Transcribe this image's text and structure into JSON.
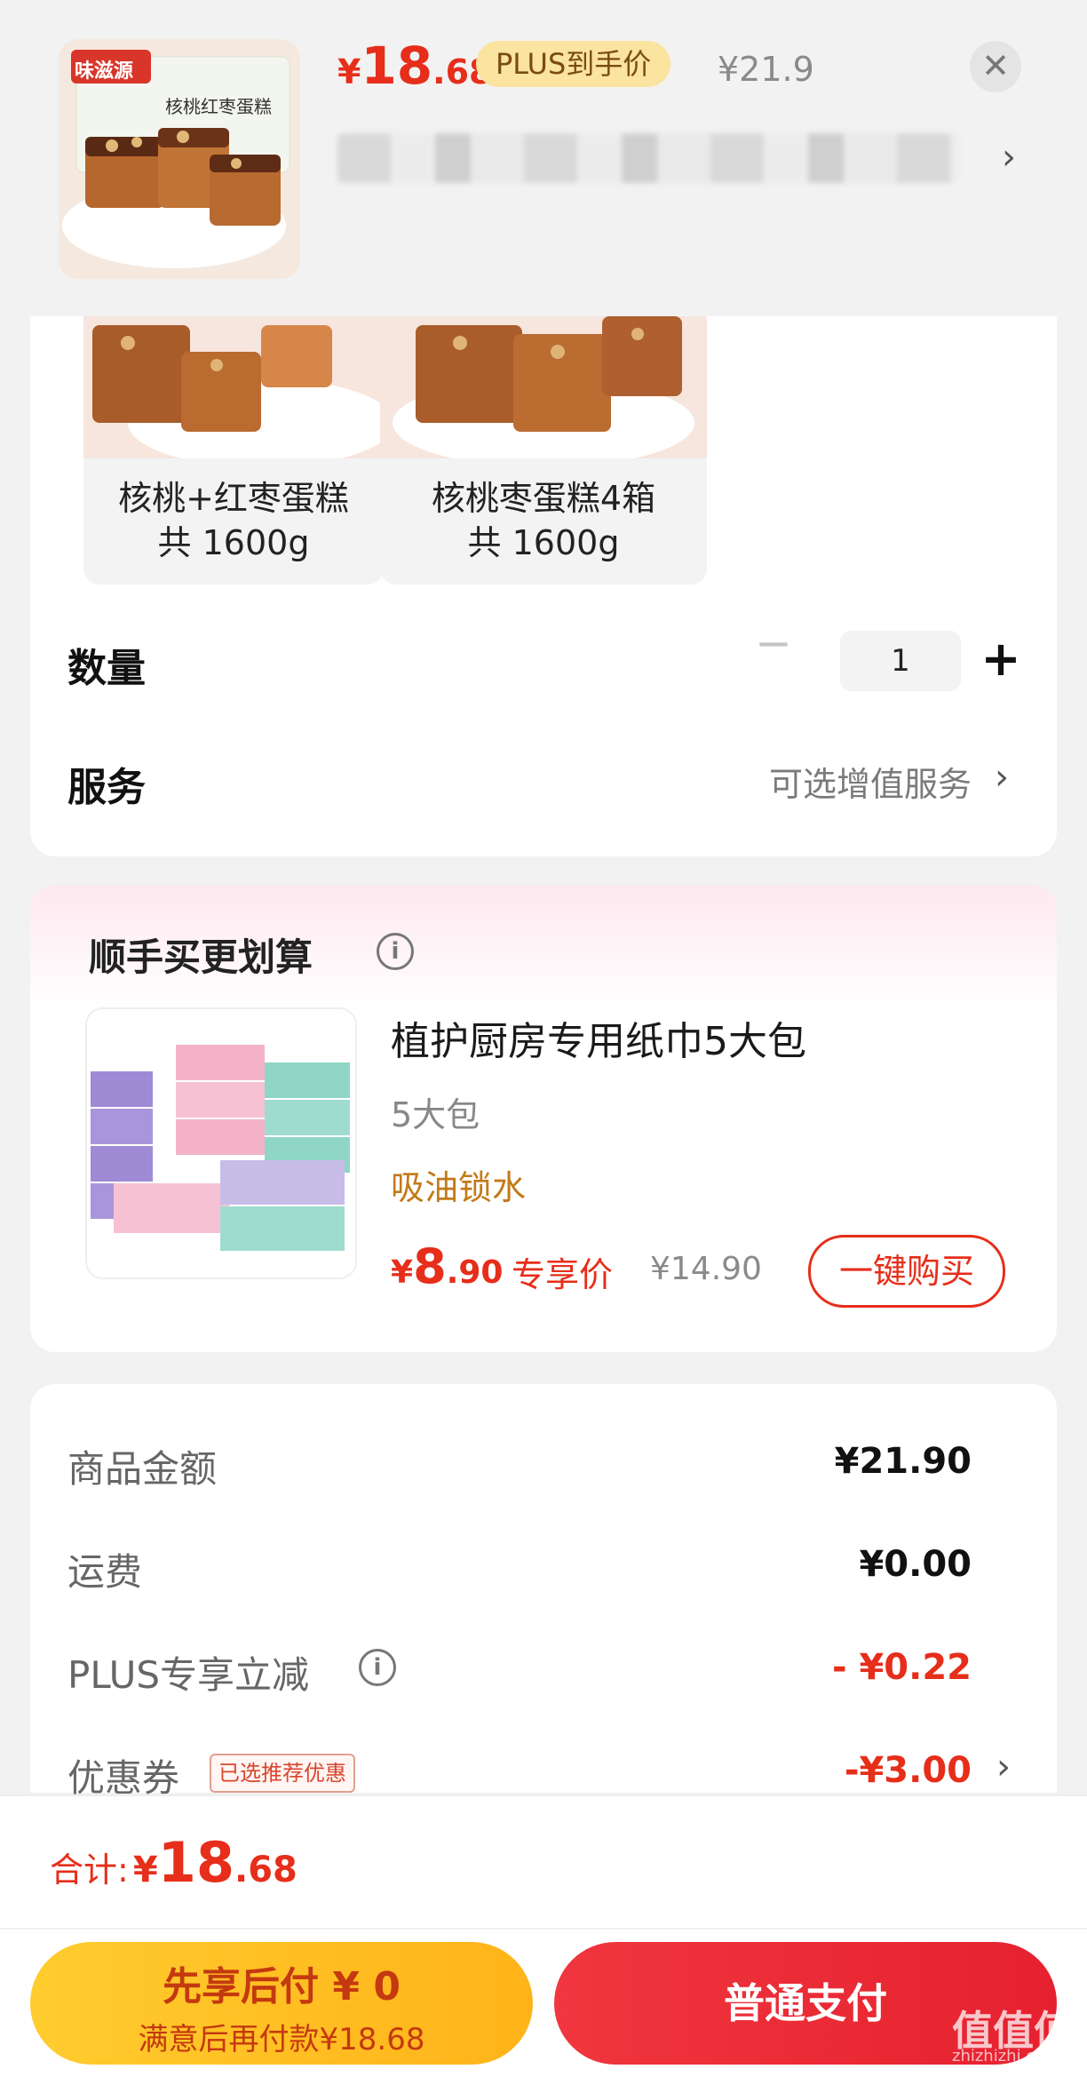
{
  "header": {
    "product_image_text": "味滋源",
    "product_image_caption": "核桃红枣蛋糕",
    "price": {
      "currency": "¥",
      "integer": "18",
      "decimal": ".68"
    },
    "plus_badge": "PLUS到手价",
    "original_price": "¥21.9",
    "close_symbol": "✕",
    "chevron": "›"
  },
  "specs": {
    "items": [
      {
        "name": "核桃+红枣蛋糕",
        "weight": "共 1600g"
      },
      {
        "name": "核桃枣蛋糕4箱",
        "weight": "共 1600g"
      }
    ]
  },
  "quantity": {
    "label": "数量",
    "value": "1",
    "minus": "−",
    "plus": "+"
  },
  "service": {
    "label": "服务",
    "hint": "可选增值服务",
    "chevron": "›"
  },
  "bundle": {
    "title": "顺手买更划算",
    "info_symbol": "i",
    "product": {
      "name": "植护厨房专用纸巾5大包",
      "spec": "5大包",
      "tag": "吸油锁水",
      "price": {
        "currency": "¥",
        "integer": "8",
        "decimal": ".90"
      },
      "exclusive_label": "专享价",
      "original_price": "¥14.90",
      "buy_button": "一键购买"
    }
  },
  "summary": {
    "rows": [
      {
        "label": "商品金额",
        "value": "¥21.90"
      },
      {
        "label": "运费",
        "value": "¥0.00"
      },
      {
        "label": "PLUS专享立减",
        "value": "- ¥0.22"
      },
      {
        "label": "优惠券",
        "value": "-¥3.00"
      }
    ],
    "coupon_badge": "已选推荐优惠",
    "info_symbol": "i",
    "chevron": "›"
  },
  "footer": {
    "total_label": "合计:",
    "total": {
      "currency": "¥",
      "integer": "18",
      "decimal": ".68"
    },
    "pay_later_title": "先享后付 ¥ 0",
    "pay_later_sub": "满意后再付款¥18.68",
    "pay_button": "普通支付"
  },
  "watermark": {
    "text": "值值值",
    "sub": "zhizhizhi.com"
  },
  "colors": {
    "accent_red": "#e62e1a",
    "gold": "#ffc22a",
    "tag_orange": "#c27a18"
  },
  "icons": [
    "close-icon",
    "chevron-right-icon",
    "info-icon",
    "minus-icon",
    "plus-icon"
  ]
}
